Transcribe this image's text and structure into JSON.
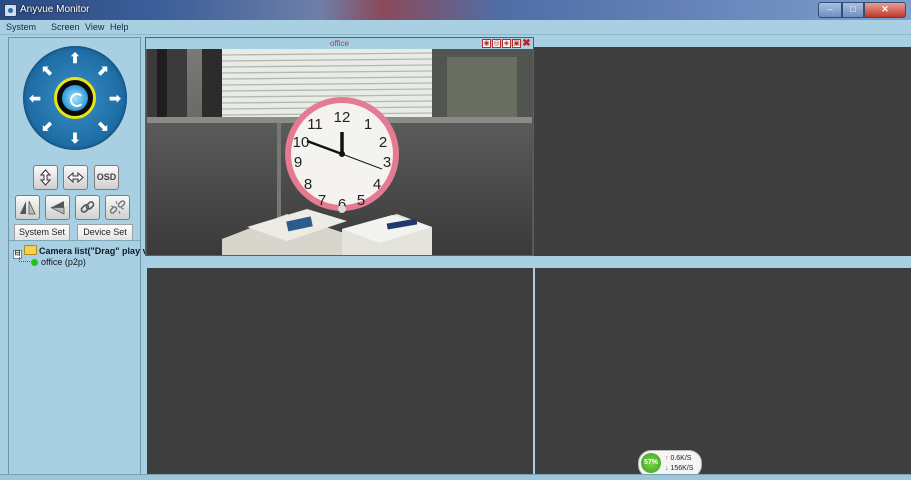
{
  "window": {
    "title": "Anyvue Monitor",
    "controls": {
      "minimize": "–",
      "maximize": "□",
      "close": "✕"
    }
  },
  "menu": [
    "System",
    "Screen",
    "View",
    "Help"
  ],
  "ptz": {
    "icons": [
      "arrow-up-icon",
      "arrow-down-icon",
      "arrow-left-icon",
      "arrow-right-icon",
      "arrow-up-left-icon",
      "arrow-up-right-icon",
      "arrow-down-left-icon",
      "arrow-down-right-icon"
    ],
    "arrow_glyphs": {
      "up": "⬆",
      "down": "⬇",
      "left": "⬅",
      "right": "➡",
      "ul": "⬉",
      "ur": "⬈",
      "dl": "⬋",
      "dr": "⬊"
    }
  },
  "tools": {
    "osd_label": "OSD"
  },
  "buttons": {
    "system_set": "System Set",
    "device_set": "Device Set"
  },
  "tree": {
    "expander": "⊟",
    "root_label": "Camera list(\"Drag\" play vi",
    "children": [
      {
        "label": "office (p2p)",
        "status_color": "#22c41f"
      }
    ]
  },
  "video": {
    "tile1_title": "office",
    "tile1_icons": [
      "record-icon",
      "snapshot-icon",
      "talk-icon",
      "settings-icon",
      "close-icon"
    ],
    "tile_icon_glyphs": [
      "◉",
      "◎",
      "◈",
      "▣",
      "✖"
    ]
  },
  "speed": {
    "percent": "57%",
    "up_arrow": "↑",
    "down_arrow": "↓",
    "upload": "0.6K/S",
    "download": "156K/S"
  },
  "colors": {
    "accent": "#a9d0e2",
    "tile_bg": "#3e3e3e",
    "active_border": "#c93232",
    "ptz_blue": "#1f6fa8"
  }
}
